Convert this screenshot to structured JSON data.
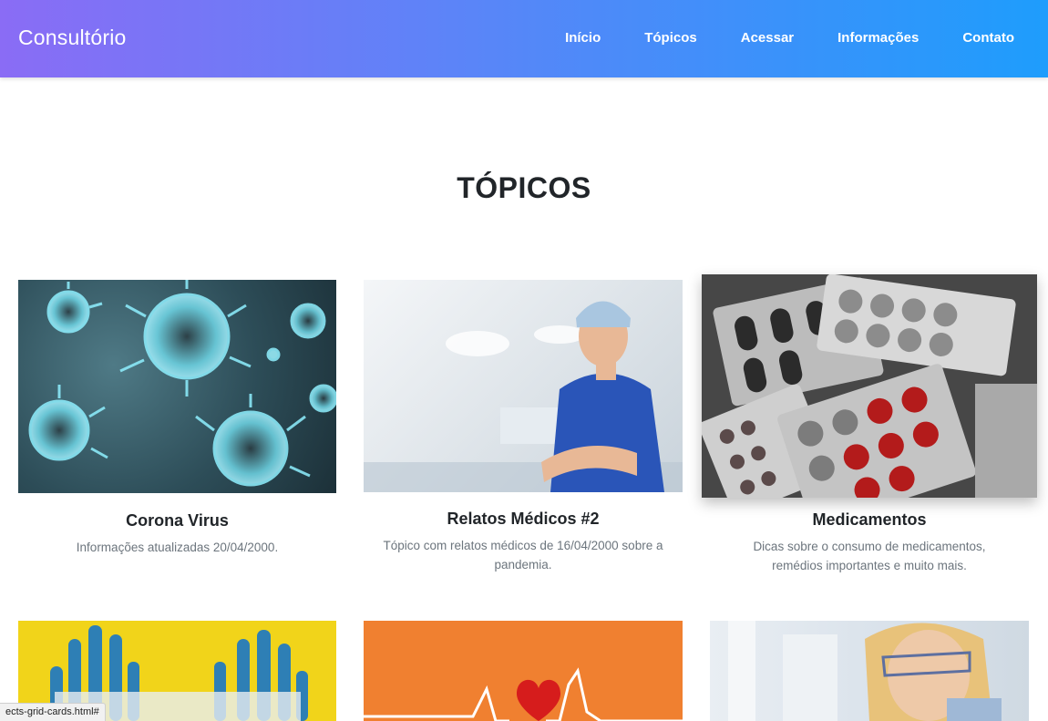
{
  "brand": "Consultório",
  "nav": [
    "Início",
    "Tópicos",
    "Acessar",
    "Informações",
    "Contato"
  ],
  "section_title": "TÓPICOS",
  "cards": [
    {
      "title": "Corona Virus",
      "text": "Informações atualizadas 20/04/2000.",
      "image": "coronavirus-image"
    },
    {
      "title": "Relatos Médicos #2",
      "text": "Tópico com relatos médicos de 16/04/2000 sobre a pandemia.",
      "image": "doctor-image"
    },
    {
      "title": "Medicamentos",
      "text": "Dicas sobre o consumo de medicamentos, remédios importantes e muito mais.",
      "image": "pills-image"
    },
    {
      "title": "",
      "text": "",
      "image": "gloves-image"
    },
    {
      "title": "",
      "text": "",
      "image": "heartbeat-image"
    },
    {
      "title": "",
      "text": "",
      "image": "researcher-image"
    }
  ],
  "status_url": "ects-grid-cards.html#",
  "colors": {
    "nav_start": "#8a6cf5",
    "nav_end": "#1e9dfc",
    "heading": "#212529",
    "muted": "#6c757d"
  }
}
